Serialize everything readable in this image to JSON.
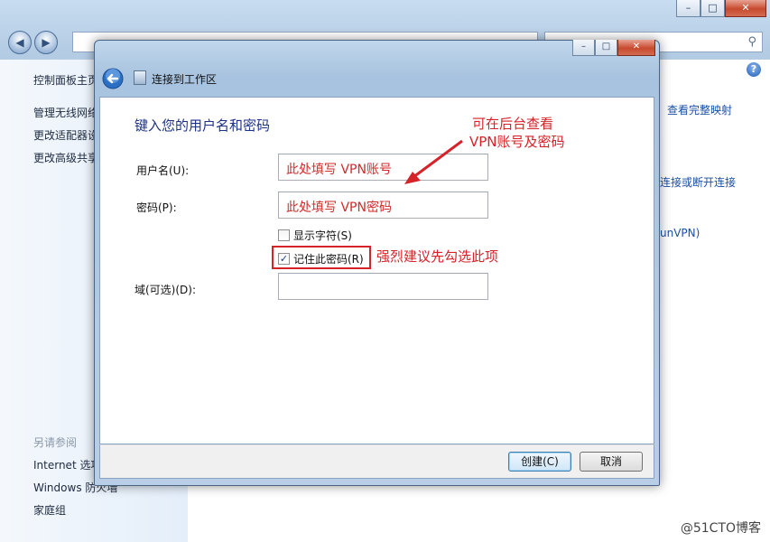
{
  "background_window": {
    "caption_buttons": [
      "–",
      "□",
      "✕"
    ],
    "sidebar": {
      "items": [
        "控制面板主页",
        "管理无线网络",
        "更改适配器设置",
        "更改高级共享设置"
      ],
      "see_also_heading": "另请参阅",
      "see_also_items": [
        "Internet 选项",
        "Windows 防火墙",
        "家庭组"
      ]
    },
    "right_links": [
      "查看完整映射",
      "连接或断开连接",
      "unVPN)"
    ]
  },
  "dialog": {
    "caption_buttons": [
      "–",
      "□",
      "✕"
    ],
    "title": "连接到工作区",
    "heading": "键入您的用户名和密码",
    "username_label": "用户名(U):",
    "username_value": "此处填写 VPN账号",
    "password_label": "密码(P):",
    "password_value": "此处填写 VPN密码",
    "show_chars_label": "显示字符(S)",
    "show_chars_checked": false,
    "remember_label": "记住此密码(R)",
    "remember_checked": true,
    "domain_label": "域(可选)(D):",
    "domain_value": "",
    "create_button": "创建(C)",
    "cancel_button": "取消"
  },
  "annotations": {
    "top_line1": "可在后台查看",
    "top_line2": "VPN账号及密码",
    "remember_note": "强烈建议先勾选此项",
    "color": "#d6232a"
  },
  "watermark": "@51CTO博客"
}
